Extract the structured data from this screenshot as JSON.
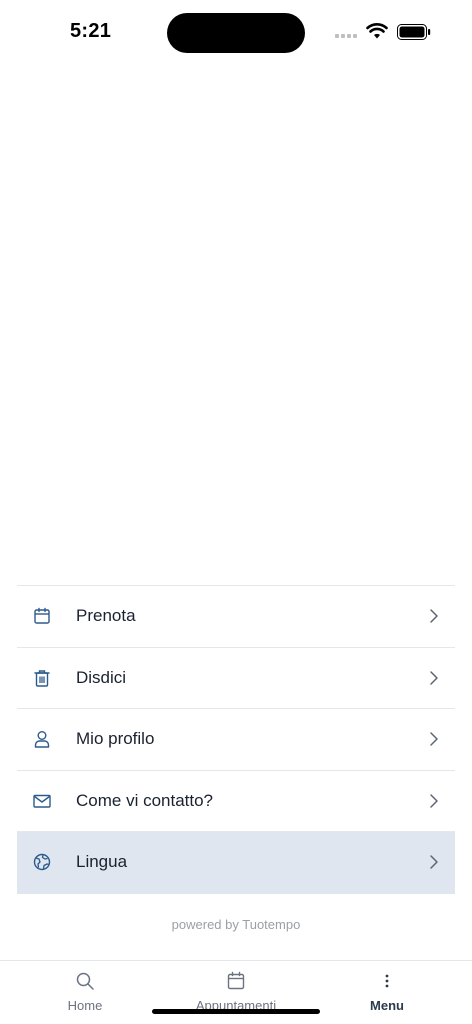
{
  "status_bar": {
    "time": "5:21"
  },
  "menu": {
    "items": [
      {
        "label": "Prenota",
        "icon": "calendar-icon",
        "active": false
      },
      {
        "label": "Disdici",
        "icon": "trash-icon",
        "active": false
      },
      {
        "label": "Mio profilo",
        "icon": "user-icon",
        "active": false
      },
      {
        "label": "Come vi contatto?",
        "icon": "mail-icon",
        "active": false
      },
      {
        "label": "Lingua",
        "icon": "globe-icon",
        "active": true
      }
    ]
  },
  "footer": {
    "powered_by": "powered by Tuotempo"
  },
  "tabbar": {
    "tabs": [
      {
        "label": "Home",
        "icon": "search-icon",
        "active": false
      },
      {
        "label": "Appuntamenti",
        "icon": "calendar-icon",
        "active": false
      },
      {
        "label": "Menu",
        "icon": "more-vertical-icon",
        "active": true
      }
    ]
  },
  "colors": {
    "accent": "#2d5a8c",
    "active_row_bg": "#dfe6ef",
    "divider": "#e4e6ea",
    "muted_text": "#9aa0a8"
  }
}
